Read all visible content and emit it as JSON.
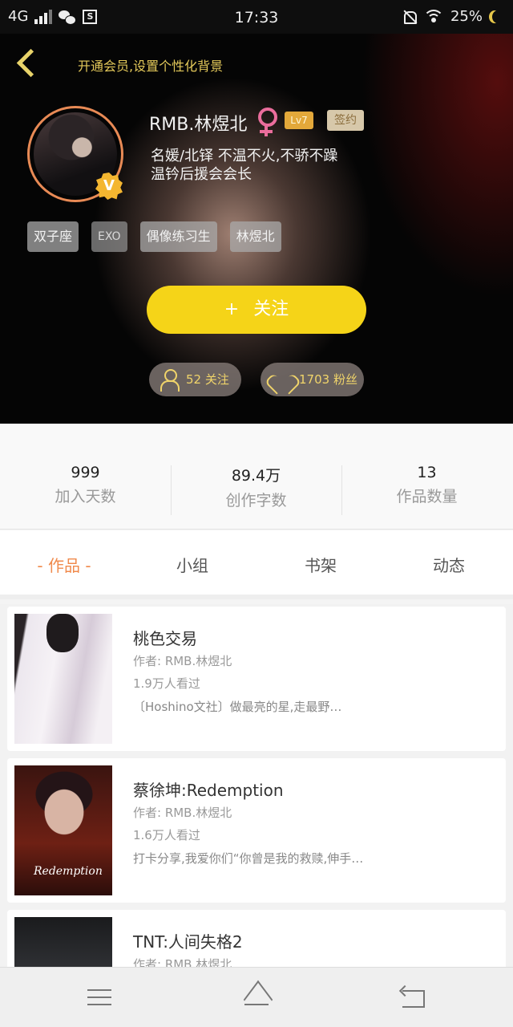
{
  "status_bar": {
    "network": "4G",
    "time": "17:33",
    "battery": "25%",
    "icons": [
      "signal-icon",
      "wechat-icon",
      "s-app-icon",
      "bell-off-icon",
      "wifi-icon",
      "moon-icon"
    ]
  },
  "header": {
    "vip_link": "开通会员,设置个性化背景",
    "username": "RMB.林煜北",
    "gender_icon": "female-icon",
    "level": "Lv7",
    "sign_badge": "签约",
    "bio_line1": "名媛/北铎 不温不火,不骄不躁",
    "bio_line2": "温钤后援会会长",
    "verified_badge": "V",
    "tags": [
      "双子座",
      "EXO",
      "偶像练习生",
      "林煜北"
    ],
    "follow_button": "关注",
    "follow_plus": "+",
    "following": "52 关注",
    "fans": "1703 粉丝",
    "accent_color": "#f5d418"
  },
  "stats": [
    {
      "value": "999",
      "label": "加入天数"
    },
    {
      "value": "89.4万",
      "label": "创作字数"
    },
    {
      "value": "13",
      "label": "作品数量"
    }
  ],
  "tabs": [
    {
      "label": "- 作品 -",
      "active": true
    },
    {
      "label": "小组",
      "active": false
    },
    {
      "label": "书架",
      "active": false
    },
    {
      "label": "动态",
      "active": false
    }
  ],
  "works": [
    {
      "title": "桃色交易",
      "author": "作者: RMB.林煜北",
      "views": "1.9万人看过",
      "desc": "〔Hoshino文社〕做最亮的星,走最野…"
    },
    {
      "title": "蔡徐坤:Redemption",
      "author": "作者: RMB.林煜北",
      "views": "1.6万人看过",
      "desc": "打卡分享,我爱你们“你曾是我的救赎,伸手…",
      "cover_text": "Redemption"
    },
    {
      "title": "TNT:人间失格2",
      "author": "作者: RMB.林煜北",
      "views": "",
      "desc": ""
    }
  ],
  "nav_bar": {
    "icons": [
      "menu-icon",
      "home-icon",
      "back-icon"
    ]
  }
}
